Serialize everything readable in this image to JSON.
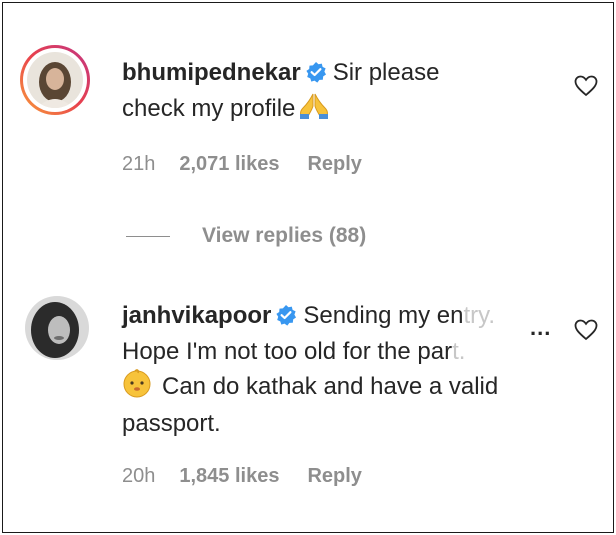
{
  "comments": [
    {
      "username": "bhumipednekar",
      "text_line1": "Sir please",
      "text_line2": "check my profile",
      "emoji": "folded-hands",
      "time": "21h",
      "likes": "2,071 likes",
      "reply_label": "Reply",
      "avatar_style": "story-ring"
    },
    {
      "username": "janhvikapoor",
      "text_line1": "Sending my en",
      "text_line1_fade": "try.",
      "text_line2": "Hope I'm not too old for the par",
      "text_line2_fade": "t.",
      "emoji": "baby-face",
      "text_line3": "Can do kathak and have a valid",
      "text_line4": "passport.",
      "more_label": "...",
      "time": "20h",
      "likes": "1,845 likes",
      "reply_label": "Reply",
      "avatar_style": "plain"
    }
  ],
  "view_replies": "View replies (88)",
  "colors": {
    "text": "#262626",
    "secondary": "#8e8e8e",
    "verified": "#3897f0",
    "ring_start": "#f9a03a",
    "ring_end": "#c13584"
  }
}
